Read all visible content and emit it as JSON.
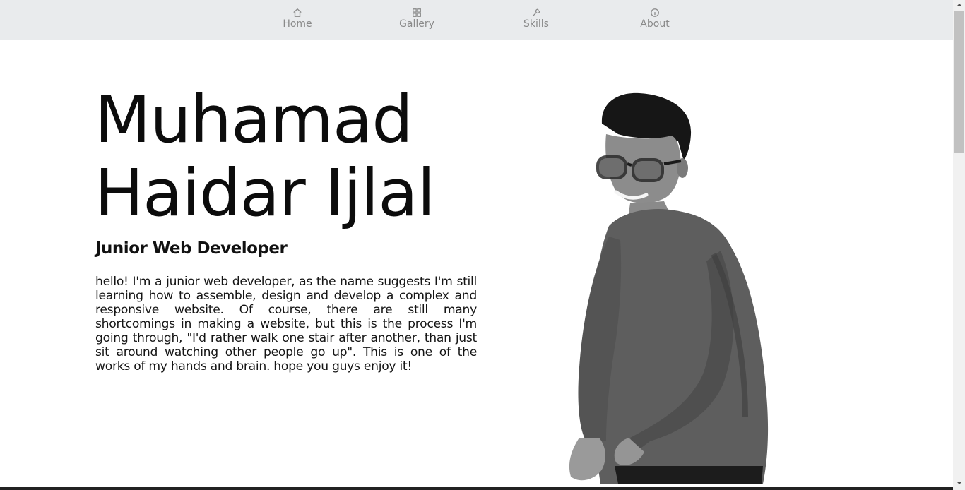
{
  "nav": {
    "items": [
      {
        "label": "Home",
        "icon": "home-icon"
      },
      {
        "label": "Gallery",
        "icon": "grid-icon"
      },
      {
        "label": "Skills",
        "icon": "wrench-icon"
      },
      {
        "label": "About",
        "icon": "info-icon"
      }
    ]
  },
  "hero": {
    "name": "Muhamad Haidar Ijlal",
    "role": "Junior Web Developer",
    "bio": "hello! I'm a junior web developer, as the name suggests I'm still learning how to assemble, design and develop a complex and responsive website. Of course, there are still many shortcomings in making a website, but this is the process I'm going through, \"I'd rather walk one stair after another, than just sit around watching other people go up\". This is one of the works of my hands and brain. hope you guys enjoy it!"
  },
  "colors": {
    "nav_bg": "#e9ebed",
    "nav_text": "#8a8a8a",
    "text": "#111111"
  }
}
